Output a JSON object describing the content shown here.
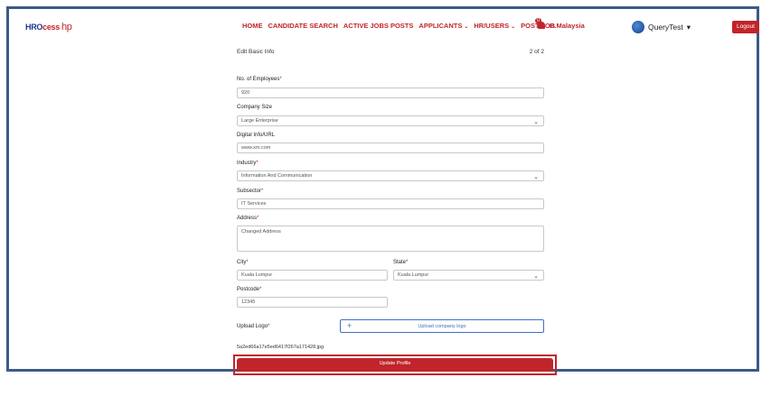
{
  "nav": {
    "logo_text": "HRO",
    "logo_suffix": "cess",
    "logo_mark": "hp",
    "menu": [
      "HOME",
      "CANDIDATE SEARCH",
      "ACTIVE JOBS POSTS",
      "APPLICANTS",
      "HR/USERS",
      "POST JOB"
    ],
    "notification_count": "0",
    "country": "B.Malaysia",
    "username": "QueryTest",
    "logout_label": "Logout"
  },
  "form": {
    "title": "Edit Basic Info",
    "step": "2 of 2",
    "employees_label": "No. of Employees",
    "employees_value": "920",
    "company_size_label": "Company Size",
    "company_size_value": "Large Enterprise",
    "digital_info_label": "Digital Info/URL",
    "digital_info_value": "www.xm.com",
    "industry_label": "Industry",
    "industry_value": "Information And Communication",
    "subsector_label": "Subsector",
    "subsector_value": "IT Services",
    "address_label": "Address",
    "address_value": "Changed Address",
    "city_label": "City",
    "city_value": "Kuala Lumpur",
    "state_label": "State",
    "state_value": "Kuala Lumpur",
    "postcode_label": "Postcode",
    "postcode_value": "12345",
    "upload_logo_label": "Upload Logo",
    "upload_button_label": "Upload company logo",
    "file_name": "5a2ed66a17e5ed6417f267a171428.jpg",
    "update_label": "Update Profile",
    "required_mark": "*"
  }
}
